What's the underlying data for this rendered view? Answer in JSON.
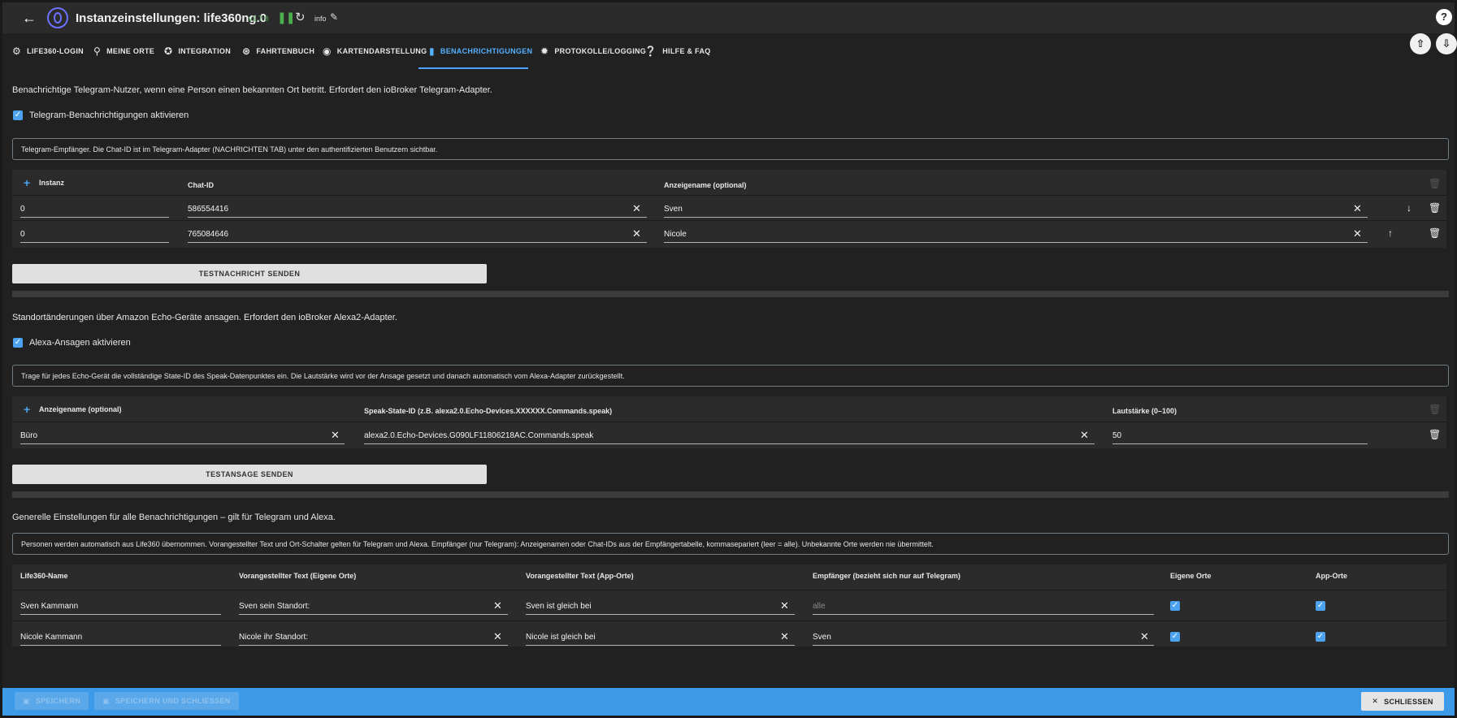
{
  "header": {
    "title": "Instanzeinstellungen: life360ng.0",
    "version": "v1.7.0",
    "info_label": "info"
  },
  "tabs": [
    {
      "label": "LIFE360-LOGIN",
      "icon": "gear-icon"
    },
    {
      "label": "MEINE ORTE",
      "icon": "map-pin-icon"
    },
    {
      "label": "INTEGRATION",
      "icon": "puzzle-icon"
    },
    {
      "label": "FAHRTENBUCH",
      "icon": "route-icon"
    },
    {
      "label": "KARTENDARSTELLUNG",
      "icon": "palette-icon"
    },
    {
      "label": "BENACHRICHTIGUNGEN",
      "icon": "bookmark-icon",
      "active": true
    },
    {
      "label": "PROTOKOLLE/LOGGING",
      "icon": "bug-icon"
    },
    {
      "label": "HILFE & FAQ",
      "icon": "help-icon"
    }
  ],
  "telegram": {
    "intro": "Benachrichtige Telegram-Nutzer, wenn eine Person einen bekannten Ort betritt. Erfordert den ioBroker Telegram-Adapter.",
    "enable_label": "Telegram-Benachrichtigungen aktivieren",
    "info": "Telegram-Empfänger. Die Chat-ID ist im Telegram-Adapter (NACHRICHTEN TAB) unter den authentifizierten Benutzern sichtbar.",
    "columns": [
      "Instanz",
      "Chat-ID",
      "Anzeigename (optional)"
    ],
    "rows": [
      {
        "instanz": "0",
        "chat_id": "586554416",
        "name": "Sven"
      },
      {
        "instanz": "0",
        "chat_id": "765084646",
        "name": "Nicole"
      }
    ],
    "test_button": "TESTNACHRICHT SENDEN"
  },
  "alexa": {
    "intro": "Standortänderungen über Amazon Echo-Geräte ansagen. Erfordert den ioBroker Alexa2-Adapter.",
    "enable_label": "Alexa-Ansagen aktivieren",
    "info": "Trage für jedes Echo-Gerät die vollständige State-ID des Speak-Datenpunktes ein. Die Lautstärke wird vor der Ansage gesetzt und danach automatisch vom Alexa-Adapter zurückgestellt.",
    "columns": [
      "Anzeigename (optional)",
      "Speak-State-ID (z.B. alexa2.0.Echo-Devices.XXXXXX.Commands.speak)",
      "Lautstärke (0–100)"
    ],
    "rows": [
      {
        "name": "Büro",
        "state_id": "alexa2.0.Echo-Devices.G090LF11806218AC.Commands.speak",
        "volume": "50"
      }
    ],
    "test_button": "TESTANSAGE SENDEN"
  },
  "general": {
    "intro": "Generelle Einstellungen für alle Benachrichtigungen – gilt für Telegram und Alexa.",
    "info": "Personen werden automatisch aus Life360 übernommen. Vorangestellter Text und Ort-Schalter gelten für Telegram und Alexa. Empfänger (nur Telegram): Anzeigenamen oder Chat-IDs aus der Empfängertabelle, kommasepariert (leer = alle). Unbekannte Orte werden nie übermittelt.",
    "columns": [
      "Life360-Name",
      "Vorangestellter Text (Eigene Orte)",
      "Vorangestellter Text (App-Orte)",
      "Empfänger (bezieht sich nur auf Telegram)",
      "Eigene Orte",
      "App-Orte"
    ],
    "rows": [
      {
        "name": "Sven Kammann",
        "text_own": "Sven sein Standort:",
        "text_app": "Sven ist gleich bei",
        "recipient": "",
        "recipient_placeholder": "alle",
        "own": true,
        "app": true
      },
      {
        "name": "Nicole Kammann",
        "text_own": "Nicole ihr Standort:",
        "text_app": "Nicole ist gleich bei",
        "recipient": "Sven",
        "recipient_placeholder": "",
        "own": true,
        "app": true
      }
    ]
  },
  "footer": {
    "save": "SPEICHERN",
    "save_close": "SPEICHERN UND SCHLIESSEN",
    "close": "SCHLIESSEN"
  },
  "colors": {
    "accent": "#4da3f0",
    "active_tab": "#55b0ff",
    "bottom_bar": "#3d9ae8",
    "version": "#4caf50"
  }
}
